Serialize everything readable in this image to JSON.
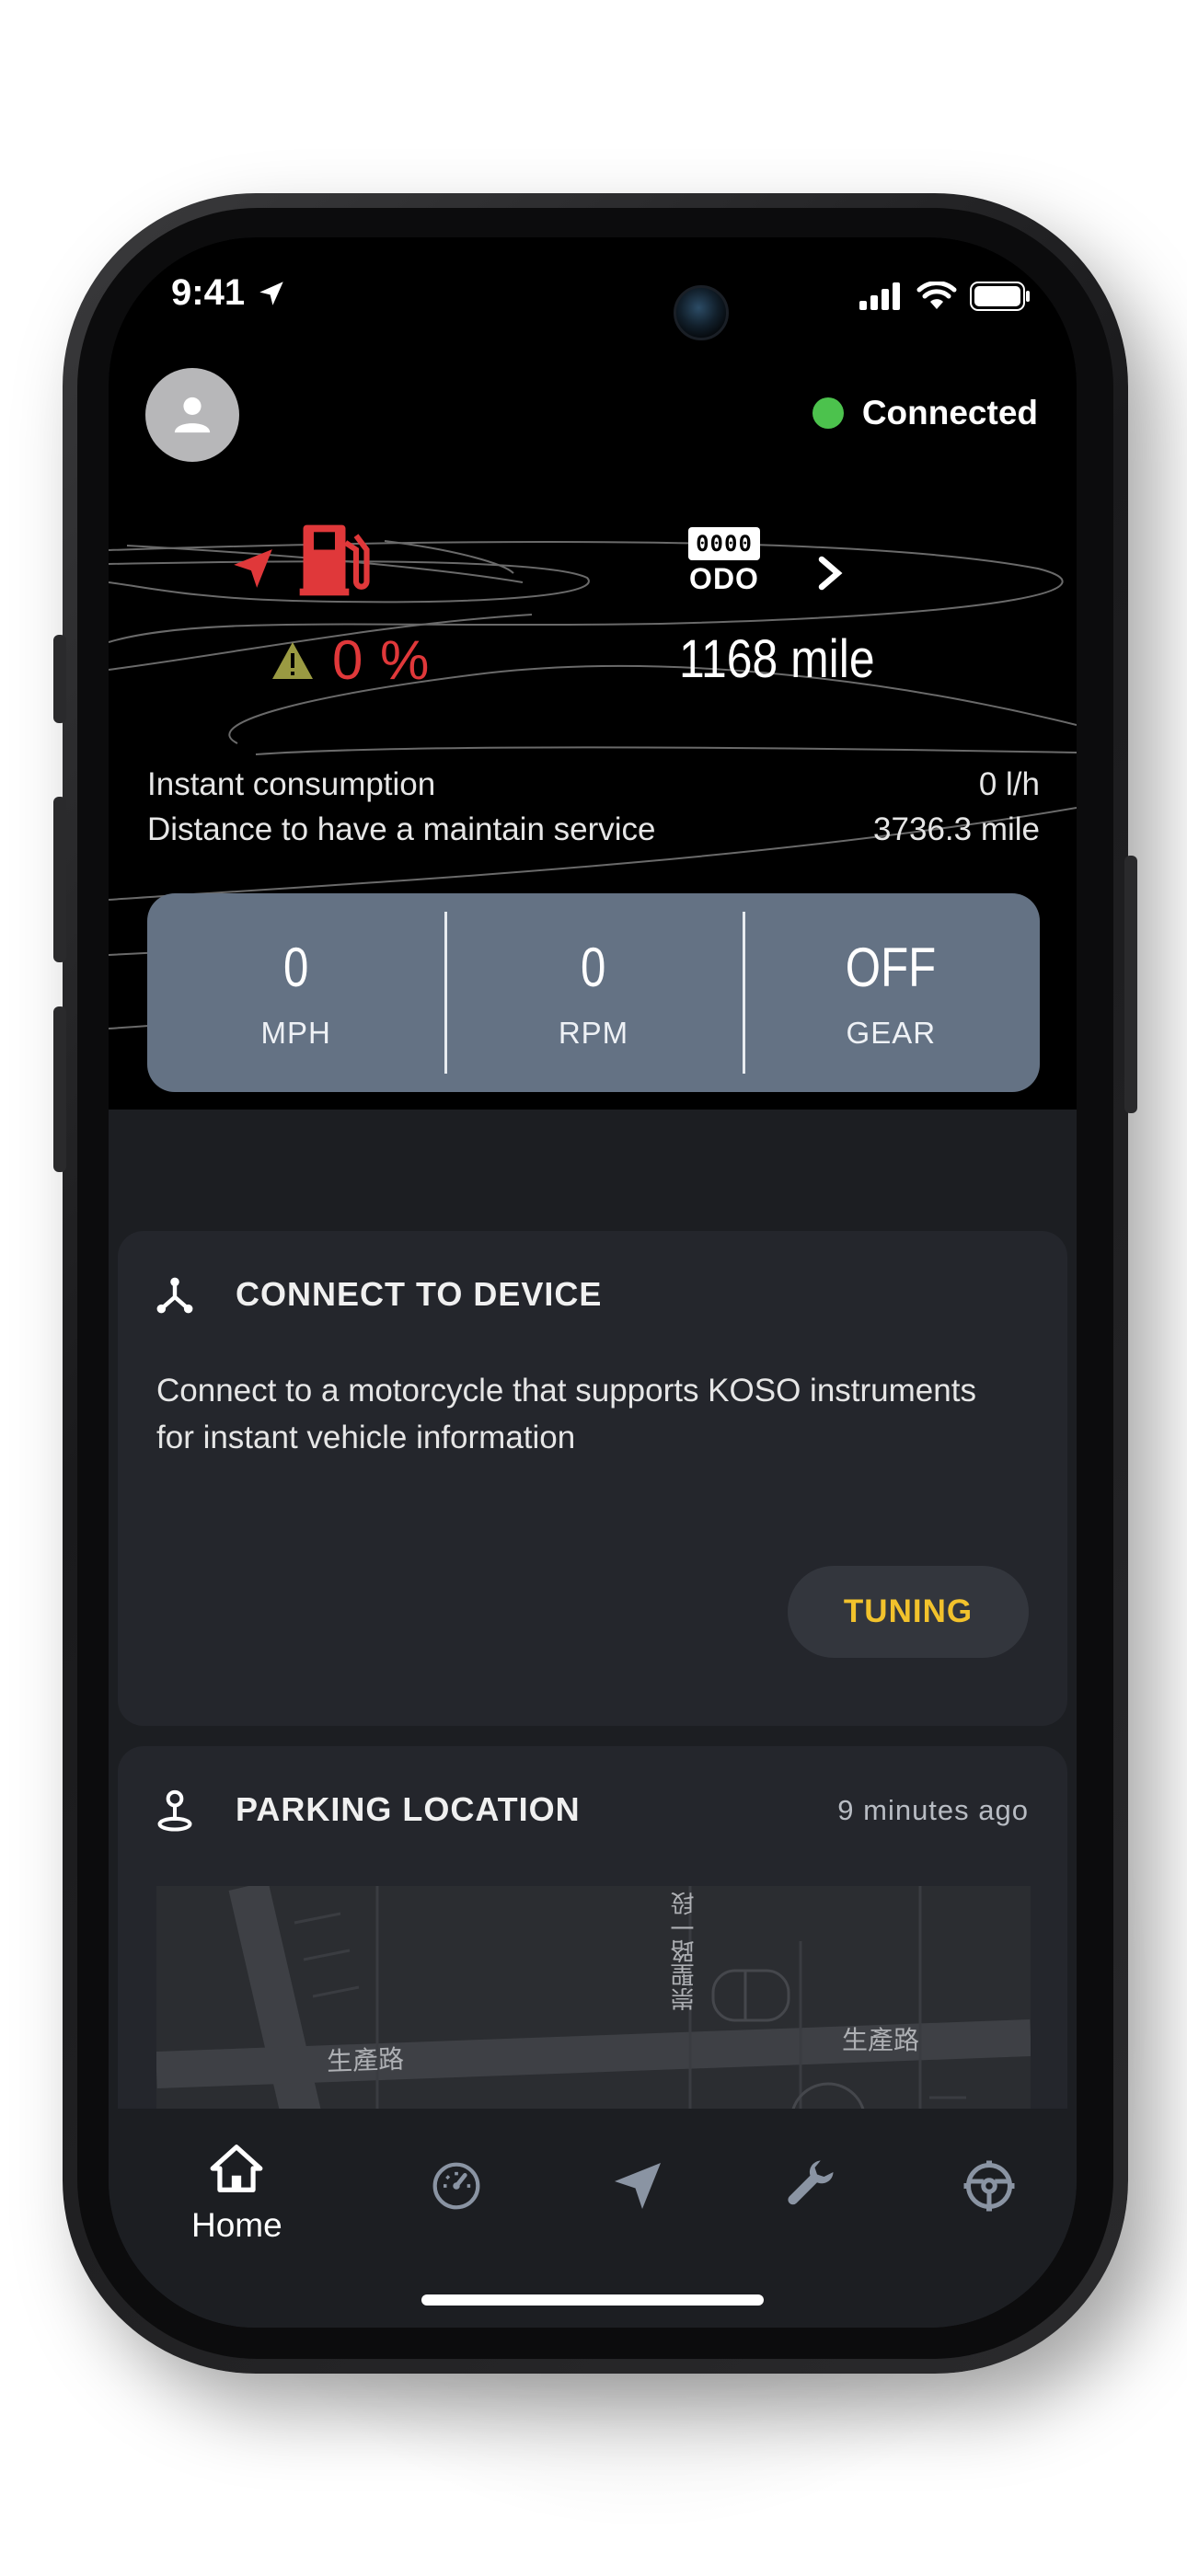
{
  "status_bar": {
    "time": "9:41"
  },
  "header": {
    "connection_status": "Connected",
    "status_color": "#4cc24d"
  },
  "fuel": {
    "value": "0 %",
    "color": "#e0383a",
    "warning_color": "#9a9a42"
  },
  "odometer": {
    "icon_digits": "0000",
    "icon_label": "ODO",
    "value": "1168 mile"
  },
  "stats": [
    {
      "label": "Instant consumption",
      "value": "0 l/h"
    },
    {
      "label": "Distance to have a maintain service",
      "value": "3736.3 mile"
    }
  ],
  "gauges": [
    {
      "value": "0",
      "label": "MPH"
    },
    {
      "value": "0",
      "label": "RPM"
    },
    {
      "value": "OFF",
      "label": "GEAR"
    }
  ],
  "connect_card": {
    "title": "CONNECT TO DEVICE",
    "description": "Connect to a motorcycle that supports KOSO instruments for instant vehicle information",
    "button": "TUNING",
    "button_color": "#f2c22c"
  },
  "parking_card": {
    "title": "PARKING LOCATION",
    "time_ago": "9 minutes ago",
    "map_labels": [
      "生產路",
      "生產路",
      "崇聖路一段"
    ]
  },
  "tabbar": {
    "active_label": "Home",
    "items": [
      "home-icon",
      "dashboard-icon",
      "navigation-icon",
      "tools-icon",
      "settings-icon"
    ]
  }
}
